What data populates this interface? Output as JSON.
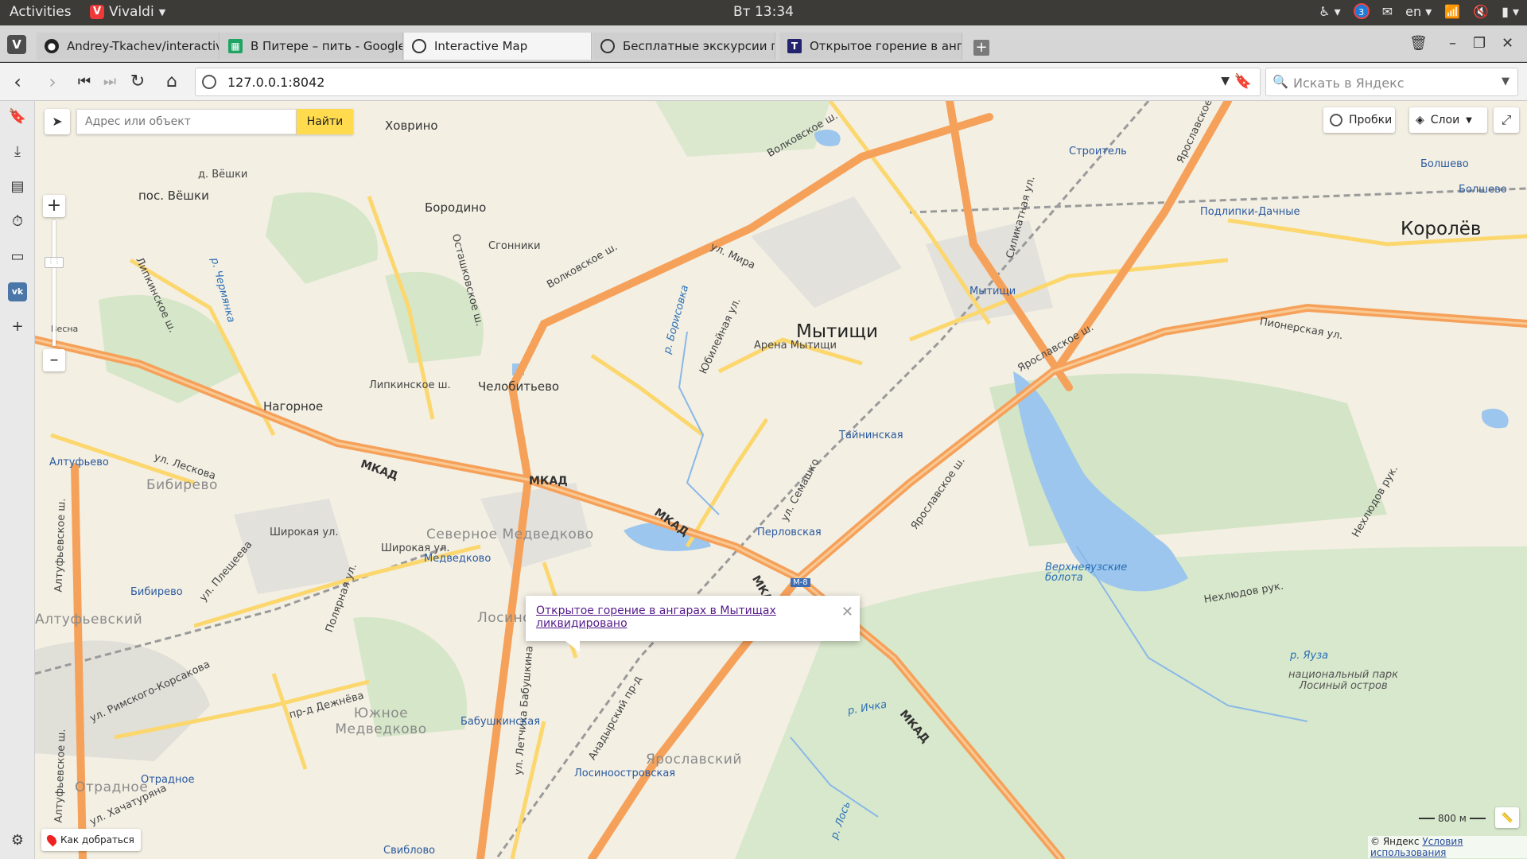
{
  "os": {
    "activities": "Activities",
    "app_name": "Vivaldi",
    "clock": "Вт 13:34",
    "notification_count": "3",
    "keyboard_layout": "en"
  },
  "tabs": [
    {
      "title": "Andrey-Tkachev/interactive",
      "icon": "github-icon",
      "active": false
    },
    {
      "title": "В Питере – пить - Google Та",
      "icon": "sheets-icon",
      "active": false
    },
    {
      "title": "Interactive Map",
      "icon": "globe-icon",
      "active": true
    },
    {
      "title": "Бесплатные экскурсии про",
      "icon": "globe-icon",
      "active": false
    },
    {
      "title": "Открытое горение в ангар",
      "icon": "tass-icon",
      "active": false
    }
  ],
  "address": {
    "url": "127.0.0.1:8042",
    "search_placeholder": "Искать в Яндекс"
  },
  "map": {
    "search_placeholder": "Адрес или объект",
    "find_label": "Найти",
    "traffic_label": "Пробки",
    "layers_label": "Слои",
    "route_label": "Как добраться",
    "scale_label": "800 м",
    "copyright": "© Яндекс",
    "terms_label": "Условия использования",
    "balloon_text": "Открытое горение в ангарах в Мытищах ликвидировано",
    "labels": {
      "mytishchi": "Мытищи",
      "korolev": "Королёв",
      "arena": "Арена Мытищи",
      "khovrino": "Ховрино",
      "vyoshki": "д. Вёшки",
      "pos_vyoshki": "пос. Вёшки",
      "borodino": "Бородино",
      "sgonniki": "Сгонники",
      "chelobitevo": "Челобитьево",
      "nagornoe": "Нагорное",
      "bibirevo": "Бибирево",
      "sev_medvedkovo": "Северное Медведково",
      "yuzh_medvedkovo": "Южное Медведково",
      "otradnoe": "Отрадное",
      "losino": "Лосино",
      "yaroslavsky": "Ярославский",
      "altufevsky": "Алтуфьевский",
      "mkad": "МКАД",
      "volkovskoe": "Волковское ш.",
      "ul_mira": "ул. Мира",
      "yaroslavskoe": "Ярославское ш.",
      "pionerskaya": "Пионерская ул.",
      "lipkinskoe": "Липкинское ш.",
      "shirokaya": "Широкая ул.",
      "ul_leskova": "ул. Лескова",
      "altufevskoe": "Алтуфьевское ш.",
      "ostashkovskoe": "Осташковское ш.",
      "yubileynaya": "Юбилейная ул.",
      "semashko": "ул. Семашко",
      "pr_dezhneva": "пр-д Дежнёва",
      "rimskogo": "ул. Римского-Корсакова",
      "plescheeva": "ул. Плещеева",
      "polyarnaya": "Полярная ул.",
      "khachaturyana": "ул. Хачатуряна",
      "letchika": "ул. Летчика Бабушкина",
      "anadyrsky": "Анадырский пр-д",
      "silikatnaya": "Силикатная ул.",
      "nekhludov": "Нехлюдов рук.",
      "m8": "М-8",
      "r_yauza": "р. Яуза",
      "r_ichka": "р. Ичка",
      "r_los": "р. Лось",
      "r_borisovka": "р. Борисовка",
      "r_chermyanka": "р. Чермянка",
      "verkhneyauzskie": "Верхнеяузские болота",
      "national_park": "национальный парк Лосиный остров",
      "st_mytishchi": "Мытищи",
      "st_taininskaya": "Тайнинская",
      "st_perlovskaya": "Перловская",
      "st_stroitel": "Строитель",
      "st_podlipki": "Подлипки-Дачные",
      "st_bolshevo": "Болшево",
      "st_losinoostrovskaya": "Лосиноостровская",
      "st_babushkinskaya": "Бабушкинская",
      "st_medvedkovo": "Медведково",
      "st_bibirevo": "Бибирево",
      "st_altufevo": "Алтуфьево",
      "st_otradnoe": "Отрадное",
      "st_sviblovo": "Свиблово",
      "vesna": "Весна"
    }
  }
}
